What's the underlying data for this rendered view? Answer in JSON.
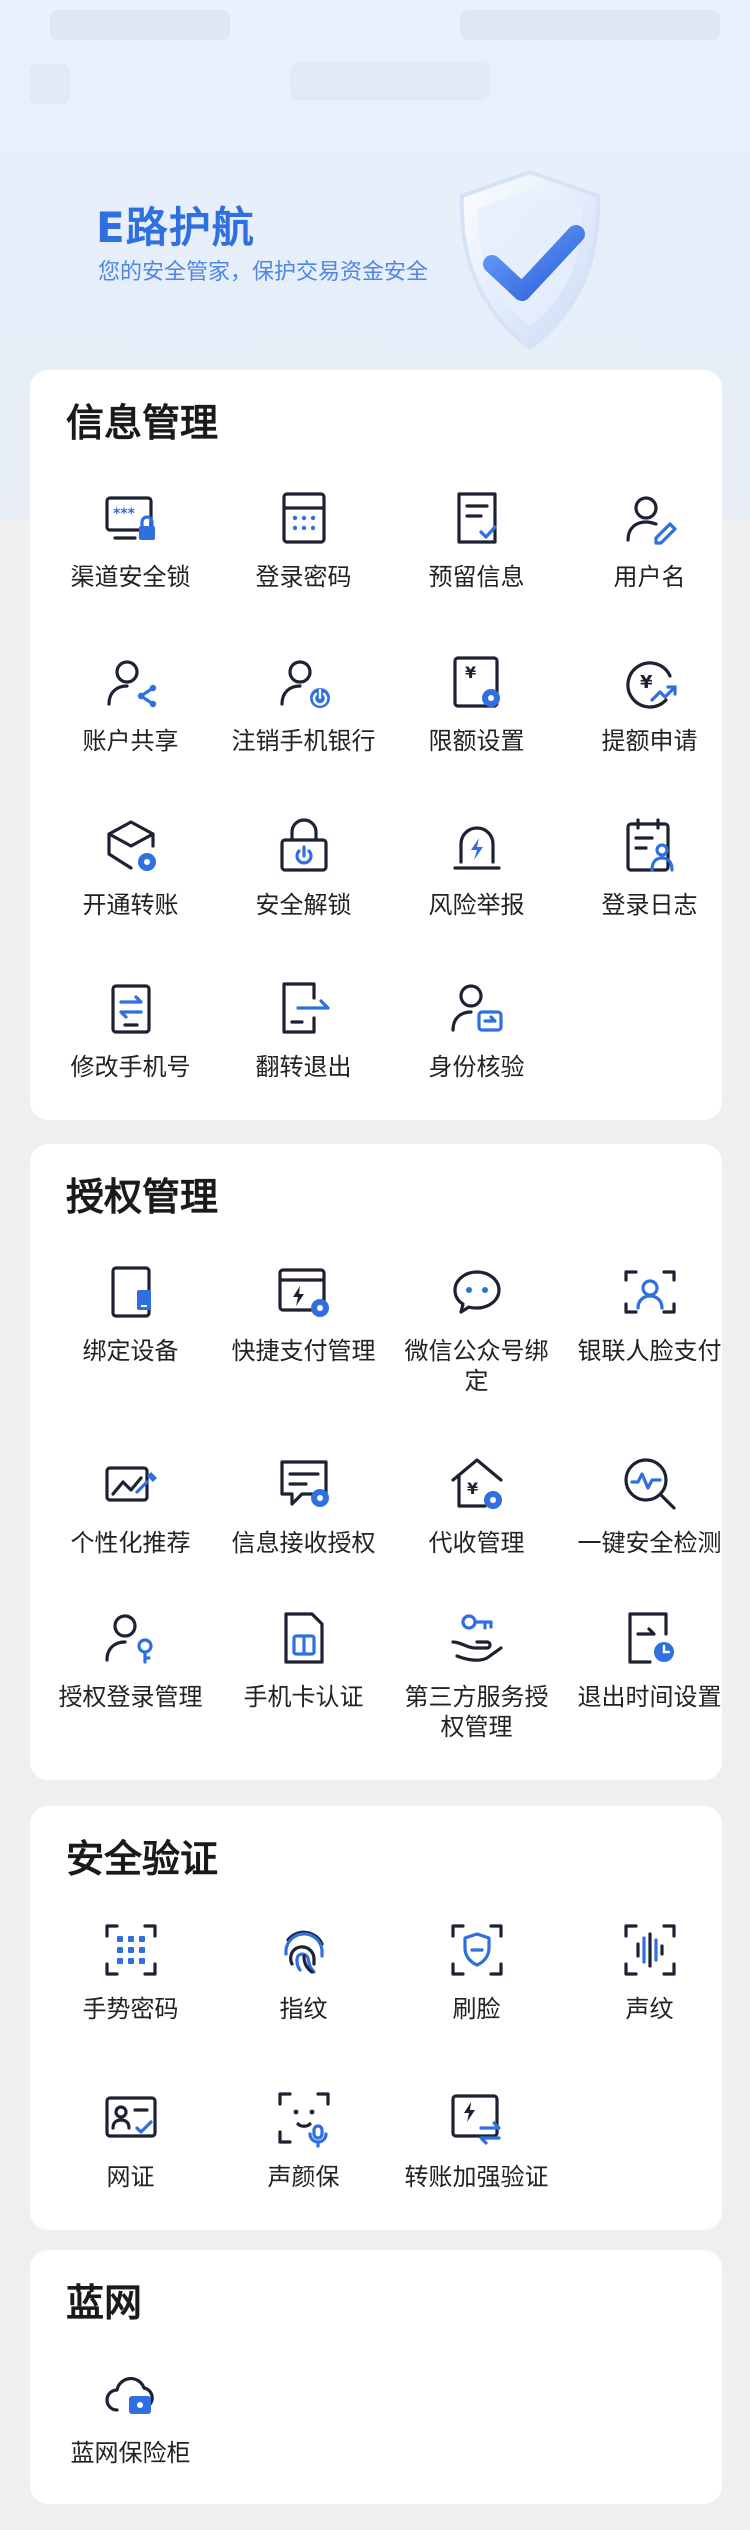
{
  "hero": {
    "title": "E路护航",
    "subtitle": "您的安全管家，保护交易资金安全"
  },
  "sections": [
    {
      "title": "信息管理",
      "items": [
        {
          "label": "渠道安全锁",
          "icon": "screen-lock-icon"
        },
        {
          "label": "登录密码",
          "icon": "keypad-icon"
        },
        {
          "label": "预留信息",
          "icon": "note-check-icon"
        },
        {
          "label": "用户名",
          "icon": "user-edit-icon"
        },
        {
          "label": "账户共享",
          "icon": "user-share-icon"
        },
        {
          "label": "注销手机银行",
          "icon": "user-power-icon"
        },
        {
          "label": "限额设置",
          "icon": "limit-settings-icon"
        },
        {
          "label": "提额申请",
          "icon": "yuan-growth-icon"
        },
        {
          "label": "开通转账",
          "icon": "transfer-gear-icon"
        },
        {
          "label": "安全解锁",
          "icon": "unlock-icon"
        },
        {
          "label": "风险举报",
          "icon": "alarm-icon"
        },
        {
          "label": "登录日志",
          "icon": "log-user-icon"
        },
        {
          "label": "修改手机号",
          "icon": "phone-swap-icon"
        },
        {
          "label": "翻转退出",
          "icon": "exit-door-icon"
        },
        {
          "label": "身份核验",
          "icon": "user-verify-icon"
        }
      ]
    },
    {
      "title": "授权管理",
      "items": [
        {
          "label": "绑定设备",
          "icon": "device-bind-icon"
        },
        {
          "label": "快捷支付管理",
          "icon": "quick-pay-icon"
        },
        {
          "label": "微信公众号绑定",
          "icon": "wechat-icon"
        },
        {
          "label": "银联人脸支付",
          "icon": "face-scan-icon"
        },
        {
          "label": "个性化推荐",
          "icon": "personalize-icon"
        },
        {
          "label": "信息接收授权",
          "icon": "message-auth-icon"
        },
        {
          "label": "代收管理",
          "icon": "collection-house-icon"
        },
        {
          "label": "一键安全检测",
          "icon": "security-check-icon"
        },
        {
          "label": "授权登录管理",
          "icon": "user-key-icon"
        },
        {
          "label": "手机卡认证",
          "icon": "sim-card-icon"
        },
        {
          "label": "第三方服务授权管理",
          "icon": "hand-key-icon"
        },
        {
          "label": "退出时间设置",
          "icon": "exit-clock-icon"
        }
      ]
    },
    {
      "title": "安全验证",
      "items": [
        {
          "label": "手势密码",
          "icon": "gesture-grid-icon"
        },
        {
          "label": "指纹",
          "icon": "fingerprint-icon"
        },
        {
          "label": "刷脸",
          "icon": "face-id-icon"
        },
        {
          "label": "声纹",
          "icon": "voiceprint-icon"
        },
        {
          "label": "网证",
          "icon": "id-card-check-icon"
        },
        {
          "label": "声颜保",
          "icon": "face-voice-icon"
        },
        {
          "label": "转账加强验证",
          "icon": "transfer-verify-icon"
        }
      ]
    },
    {
      "title": "蓝网",
      "items": [
        {
          "label": "蓝网保险柜",
          "icon": "cloud-safe-icon"
        }
      ]
    }
  ],
  "colors": {
    "accent": "#2f6fe0",
    "ink": "#1c2233",
    "card": "#ffffff",
    "page": "#efefef"
  }
}
